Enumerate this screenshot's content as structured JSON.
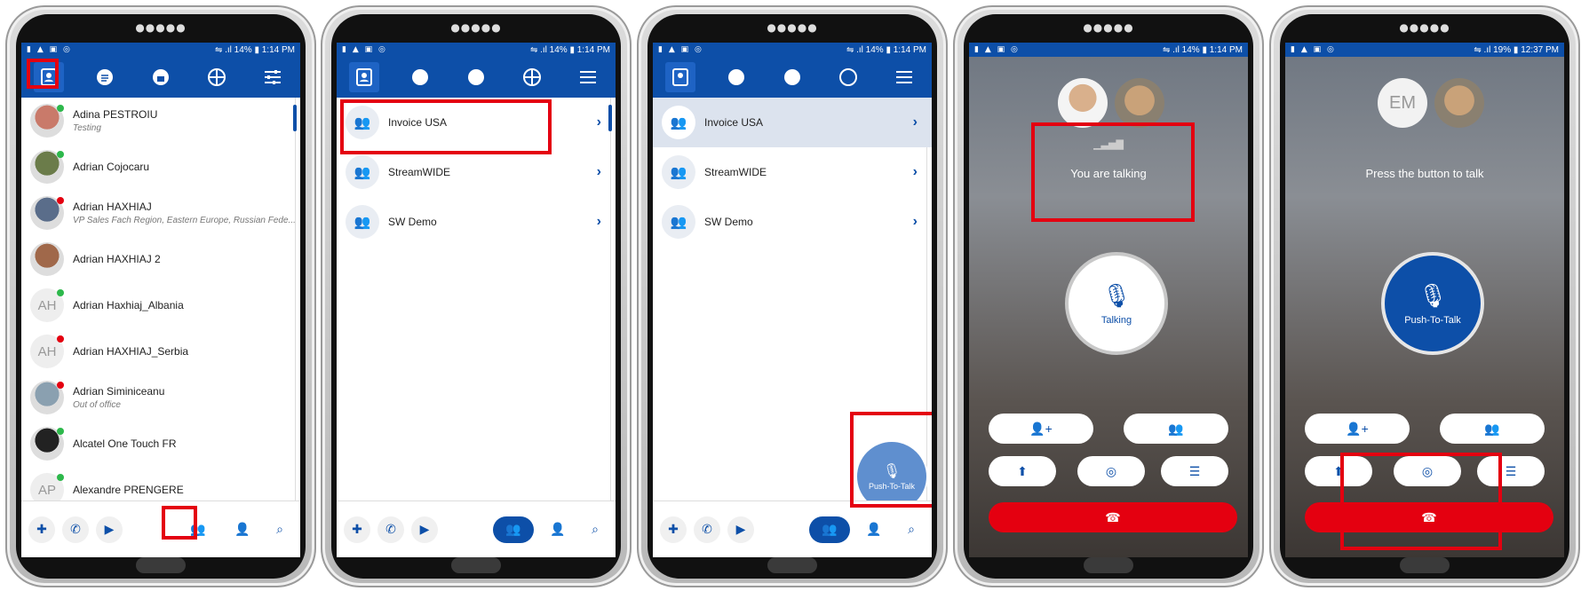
{
  "status": {
    "icons": "▮ ▲ ▣ ◎",
    "signal": "⇋ .ıl",
    "p1_battery": "14%",
    "p1_time": "1:14 PM",
    "p5_battery": "19%",
    "p5_time": "12:37 PM"
  },
  "contacts": [
    {
      "name": "Adina PESTROIU",
      "sub": "Testing",
      "initials": "",
      "color": "#c97a6a",
      "dot": "#2db84b"
    },
    {
      "name": "Adrian Cojocaru",
      "sub": "",
      "initials": "",
      "color": "#6b7c4a",
      "dot": "#2db84b"
    },
    {
      "name": "Adrian HAXHIAJ",
      "sub": "VP Sales Fach Region, Eastern Europe, Russian Fede...",
      "initials": "",
      "color": "#5a6d8a",
      "dot": "#e40010"
    },
    {
      "name": "Adrian HAXHIAJ 2",
      "sub": "",
      "initials": "",
      "color": "#a0684a",
      "dot": ""
    },
    {
      "name": "Adrian Haxhiaj_Albania",
      "sub": "",
      "initials": "AH",
      "color": "",
      "dot": "#2db84b"
    },
    {
      "name": "Adrian HAXHIAJ_Serbia",
      "sub": "",
      "initials": "AH",
      "color": "",
      "dot": "#e40010"
    },
    {
      "name": "Adrian Siminiceanu",
      "sub": "Out of office",
      "initials": "",
      "color": "#8aa0b0",
      "dot": "#e40010"
    },
    {
      "name": "Alcatel One Touch FR",
      "sub": "",
      "initials": "",
      "color": "#222",
      "dot": "#2db84b"
    },
    {
      "name": "Alexandre PRENGERE",
      "sub": "",
      "initials": "AP",
      "color": "",
      "dot": "#2db84b"
    }
  ],
  "groups": [
    "Invoice USA",
    "StreamWIDE",
    "SW Demo"
  ],
  "ptt_label": "Push-To-Talk",
  "call1": {
    "status": "You are talking",
    "btn": "Talking"
  },
  "call2": {
    "initials": "EM",
    "status": "Press the button to talk",
    "btn": "Push-To-Talk"
  },
  "colors": {
    "brand": "#0d4fa8",
    "highlight": "#e40010"
  }
}
